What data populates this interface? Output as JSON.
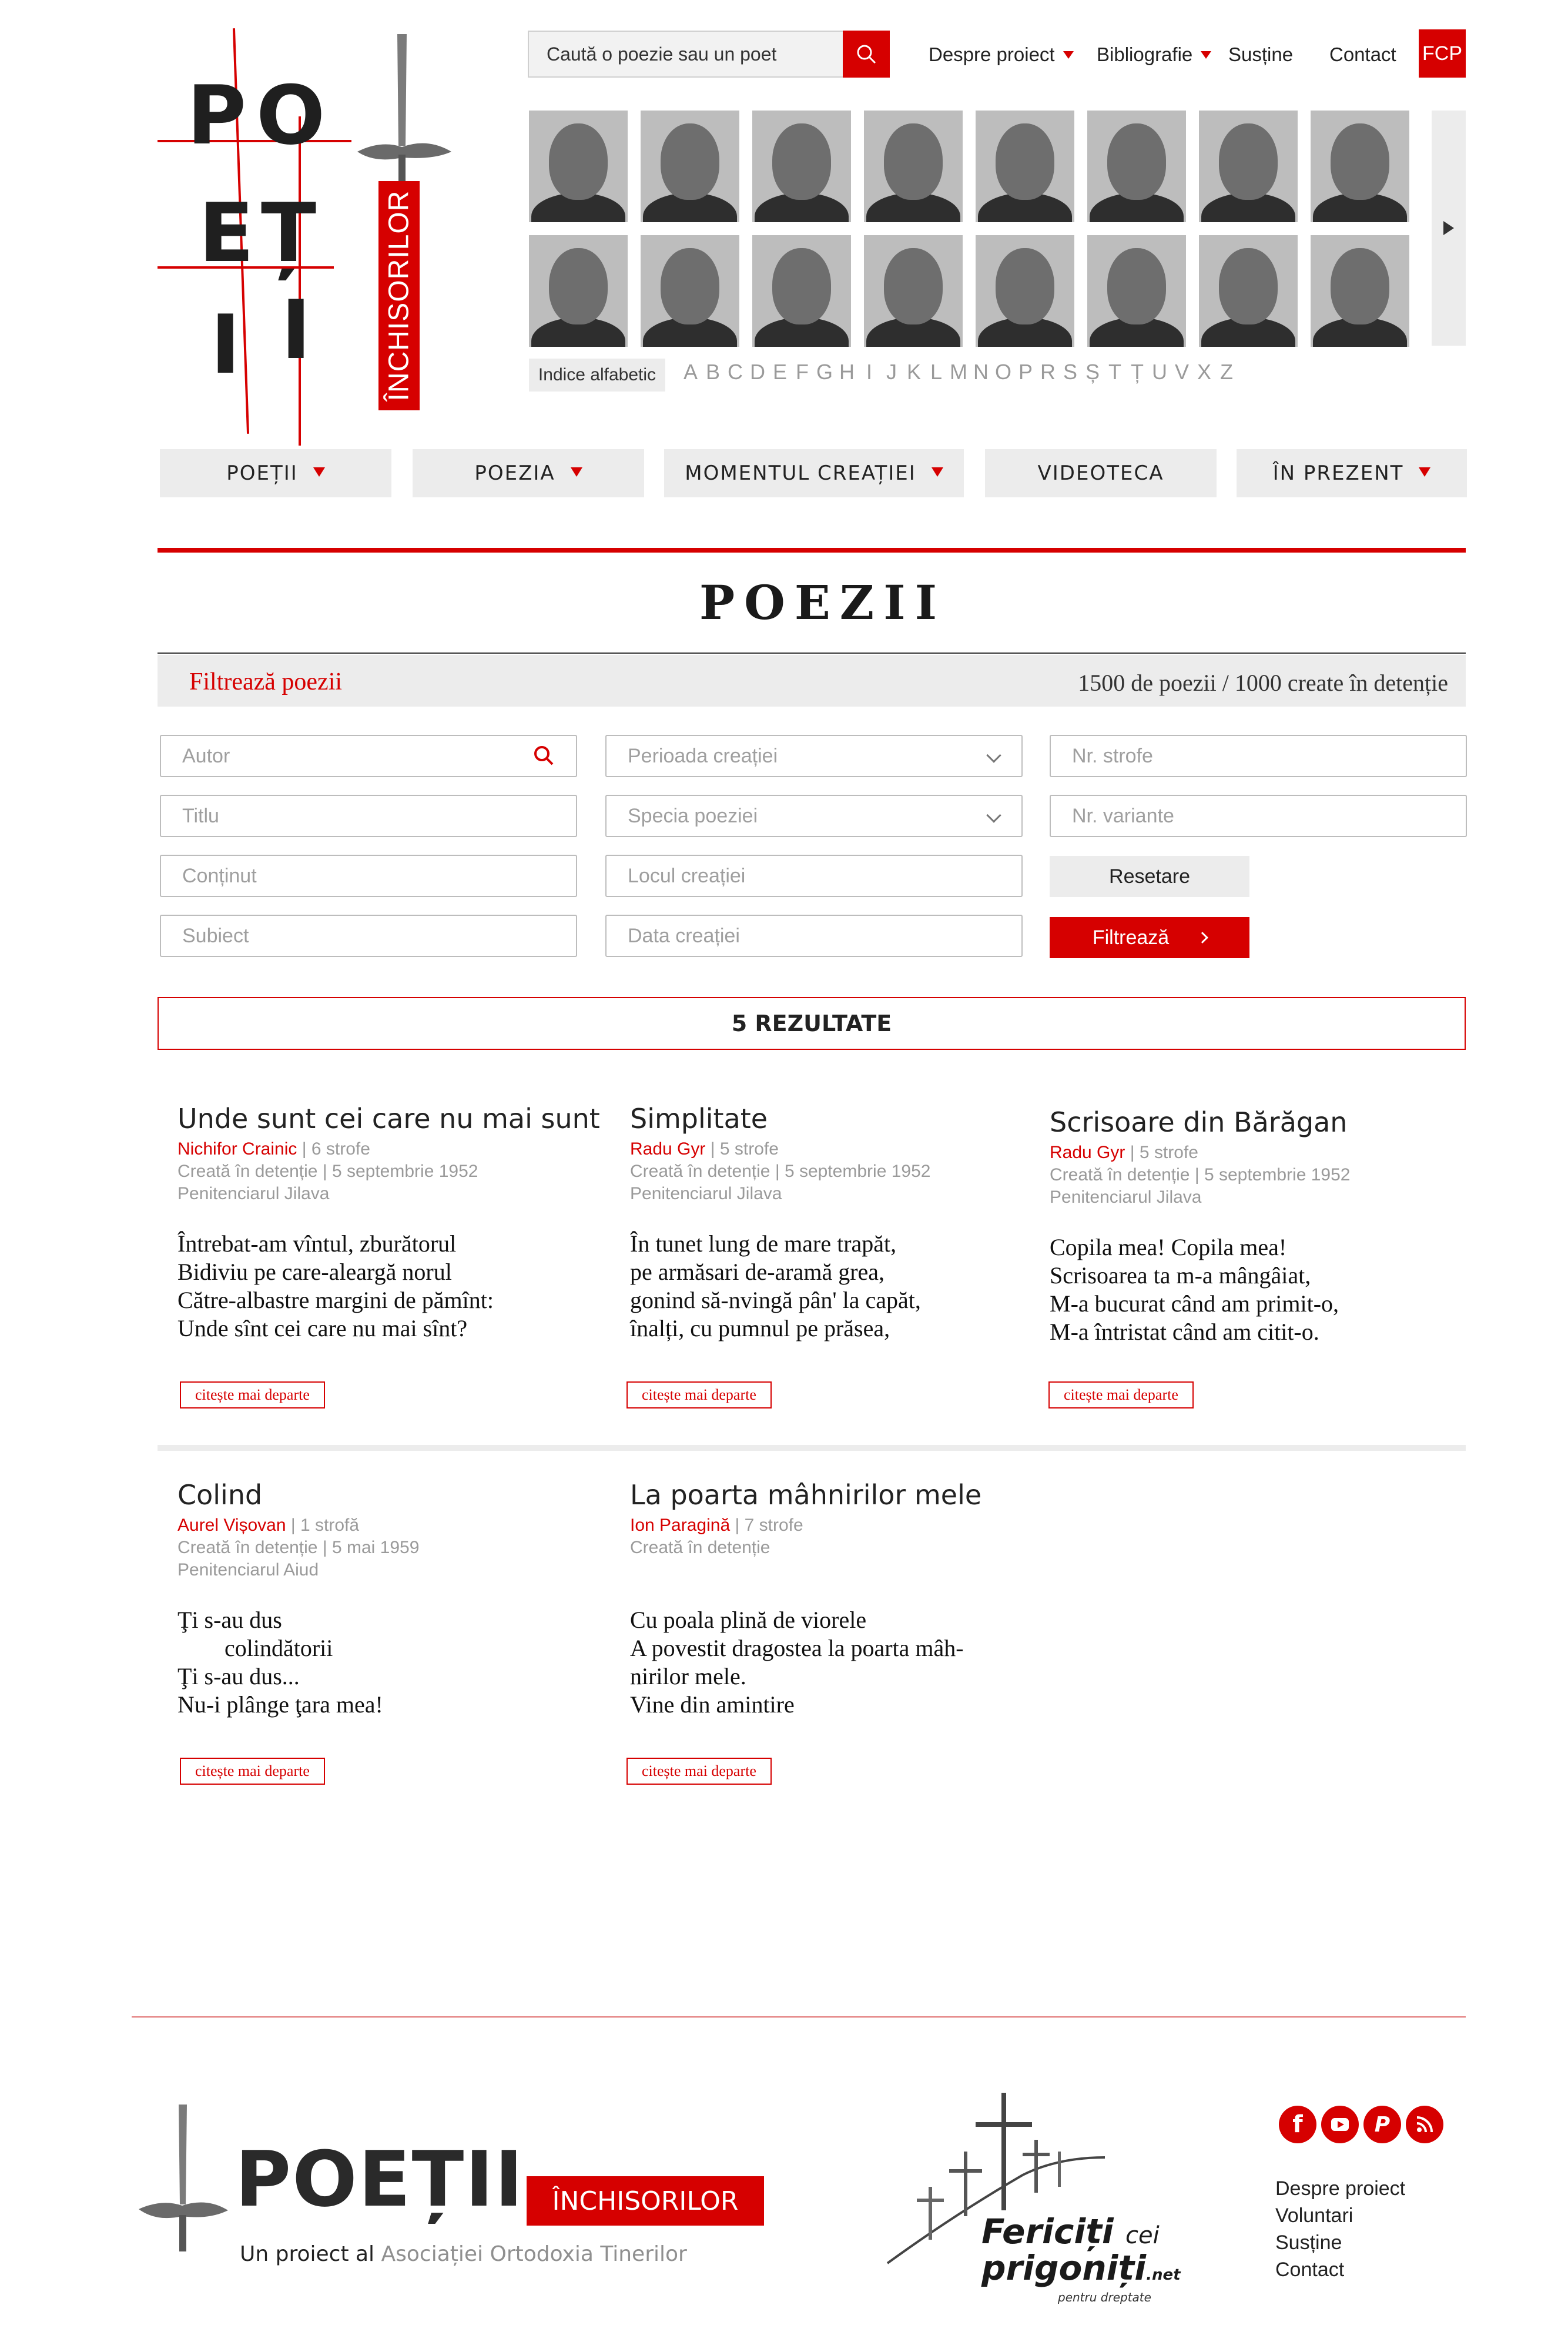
{
  "header": {
    "logo": {
      "letters": [
        "P",
        "O",
        "E",
        "Ț",
        "I",
        "I"
      ],
      "banner": "ÎNCHISORILOR"
    },
    "search": {
      "placeholder": "Caută o poezie sau un poet"
    },
    "nav": [
      {
        "label": "Despre proiect",
        "dropdown": true
      },
      {
        "label": "Bibliografie",
        "dropdown": true
      },
      {
        "label": "Susține",
        "dropdown": false
      },
      {
        "label": "Contact",
        "dropdown": false
      }
    ],
    "fcp_label": "FCP",
    "portrait_count": 16,
    "alphabet_label": "Indice alfabetic",
    "alphabet": [
      "A",
      "B",
      "C",
      "D",
      "E",
      "F",
      "G",
      "H",
      "I",
      "J",
      "K",
      "L",
      "M",
      "N",
      "O",
      "P",
      "R",
      "S",
      "Ș",
      "T",
      "Ț",
      "U",
      "V",
      "X",
      "Z"
    ]
  },
  "menu": [
    {
      "label": "POEȚII",
      "dropdown": true
    },
    {
      "label": "POEZIA",
      "dropdown": true
    },
    {
      "label": "MOMENTUL CREAȚIEI",
      "dropdown": true
    },
    {
      "label": "VIDEOTECA",
      "dropdown": false
    },
    {
      "label": "ÎN PREZENT",
      "dropdown": true
    }
  ],
  "page": {
    "title": "POEZII",
    "filter_label": "Filtrează poezii",
    "stats": "1500 de poezii / 1000 create în detenție"
  },
  "filters": {
    "autor": "Autor",
    "titlu": "Titlu",
    "continut": "Conținut",
    "subiect": "Subiect",
    "perioada": "Perioada creației",
    "specia": "Specia poeziei",
    "locul": "Locul creației",
    "data": "Data creației",
    "strofe": "Nr. strofe",
    "variante": "Nr. variante",
    "reset": "Resetare",
    "filter": "Filtrează"
  },
  "results": {
    "count_label": "5 REZULTATE",
    "more_label": "citește mai departe",
    "items": [
      {
        "title": "Unde sunt cei care nu mai sunt",
        "author": "Nichifor Crainic",
        "stanzas": "| 6 strofe",
        "created": "Creată în detenție | 5 septembrie 1952",
        "place": "Penitenciarul Jilava",
        "excerpt": "Întrebat-am vîntul, zburătorul\nBidiviu pe care-aleargă norul\nCătre-albastre margini de pămînt:\nUnde sînt cei care nu mai sînt?"
      },
      {
        "title": "Simplitate",
        "author": "Radu Gyr",
        "stanzas": " | 5 strofe",
        "created": "Creată în detenție | 5 septembrie 1952",
        "place": "Penitenciarul Jilava",
        "excerpt": "În tunet lung de mare trapăt,\npe armăsari de-aramă grea,\ngonind să-nvingă pân' la capăt,\nînalți, cu pumnul pe prăsea,"
      },
      {
        "title": "Scrisoare din Bărăgan",
        "author": "Radu Gyr",
        "stanzas": " | 5 strofe",
        "created": "Creată în detenție | 5 septembrie 1952",
        "place": "Penitenciarul Jilava",
        "excerpt": "Copila mea! Copila mea!\nScrisoarea ta m-a mângâiat,\nM-a bucurat când am primit-o,\nM-a întristat când am citit-o."
      },
      {
        "title": "Colind",
        "author": "Aurel Vișovan",
        "stanzas": " | 1 strofă",
        "created": "Creată în detenție | 5 mai 1959",
        "place": "Penitenciarul Aiud",
        "excerpt": "Ţi s-au dus\n        colindătorii\nŢi s-au dus...\nNu-i plânge ţara mea!"
      },
      {
        "title": "La poarta mâhnirilor mele",
        "author": "Ion Paragină",
        "stanzas": " | 7 strofe",
        "created": "Creată în detenție",
        "place": "",
        "excerpt": "Cu poala plină de viorele\nA povestit dragostea la poarta mâh-\nnirilor mele.\nVine din amintire"
      }
    ]
  },
  "footer": {
    "logo_text": "POEȚII",
    "logo_banner": "ÎNCHISORILOR",
    "tagline_prefix": "Un proiect al ",
    "tagline_org": "Asociației Ortodoxia Tinerilor",
    "partner": {
      "line1": "Fericiți",
      "line1b": "cei",
      "line2": "prigoniți",
      "line2b": ".net",
      "tag": "pentru dreptate"
    },
    "social": [
      "facebook-icon",
      "youtube-icon",
      "paypal-icon",
      "rss-icon"
    ],
    "links": [
      "Despre proiect",
      "Voluntari",
      "Susține",
      "Contact"
    ]
  },
  "colors": {
    "accent": "#d60000",
    "panel": "#ececec"
  }
}
